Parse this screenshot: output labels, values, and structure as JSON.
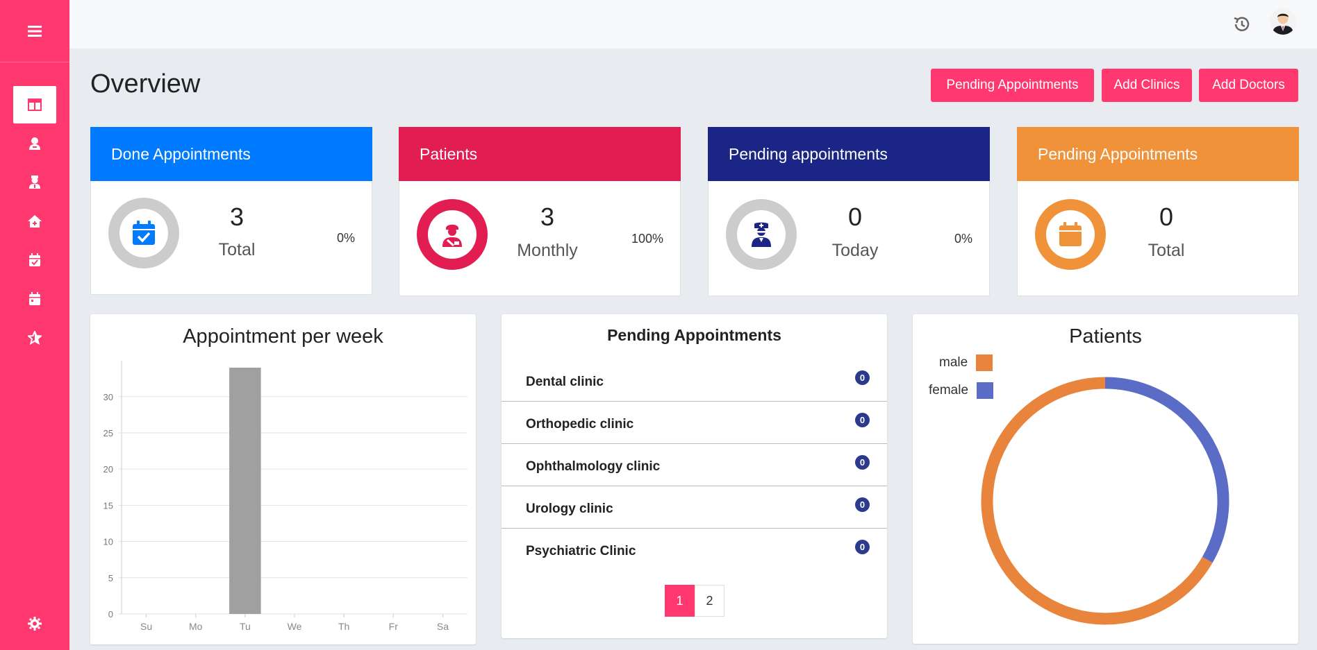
{
  "sidebar": {
    "menu_icon": "menu-icon",
    "items": [
      {
        "icon": "dashboard-icon",
        "active": true
      },
      {
        "icon": "user-icon"
      },
      {
        "icon": "doctor-icon"
      },
      {
        "icon": "clinic-icon"
      },
      {
        "icon": "calendar-check-icon"
      },
      {
        "icon": "calendar-icon"
      },
      {
        "icon": "star-icon"
      }
    ],
    "settings_icon": "gear-icon"
  },
  "topbar": {
    "history_icon": "history-icon",
    "avatar_icon": "avatar"
  },
  "header": {
    "title": "Overview",
    "buttons": [
      "Pending Appointments",
      "Add Clinics",
      "Add Doctors"
    ]
  },
  "stats": [
    {
      "title": "Done Appointments",
      "value": "3",
      "label": "Total",
      "percent": "0%",
      "color": "#007bff",
      "ring_color": "#cccccc",
      "icon_color": "#007bff",
      "icon": "calendar-check-icon"
    },
    {
      "title": "Patients",
      "value": "3",
      "label": "Monthly",
      "percent": "100%",
      "color": "#e11d52",
      "ring_color": "#e11d52",
      "icon_color": "#e11d52",
      "icon": "patient-icon"
    },
    {
      "title": "Pending appointments",
      "value": "0",
      "label": "Today",
      "percent": "0%",
      "color": "#1a2585",
      "ring_color": "#cccccc",
      "icon_color": "#1a2585",
      "icon": "nurse-icon"
    },
    {
      "title": "Pending Appointments",
      "value": "0",
      "label": "Total",
      "percent": "",
      "color": "#f0923a",
      "ring_color": "#f0923a",
      "icon_color": "#f0923a",
      "icon": "calendar-icon"
    }
  ],
  "weekly": {
    "title": "Appointment per week",
    "chart_data": {
      "type": "bar",
      "title": "Appointment per week",
      "categories": [
        "Su",
        "Mo",
        "Tu",
        "We",
        "Th",
        "Fr",
        "Sa"
      ],
      "values": [
        0,
        0,
        34,
        0,
        0,
        0,
        0
      ],
      "ylim": [
        0,
        34
      ],
      "yticks": [
        0,
        5,
        10,
        15,
        20,
        25,
        30
      ],
      "xlabel": "",
      "ylabel": "",
      "grid": true,
      "bar_color": "#a0a0a0"
    }
  },
  "pending": {
    "title": "Pending Appointments",
    "rows": [
      {
        "name": "Dental clinic",
        "count": "0"
      },
      {
        "name": "Orthopedic clinic",
        "count": "0"
      },
      {
        "name": "Ophthalmology clinic",
        "count": "0"
      },
      {
        "name": "Urology clinic",
        "count": "0"
      },
      {
        "name": "Psychiatric Clinic",
        "count": "0"
      }
    ],
    "pages": [
      "1",
      "2"
    ],
    "current_page": "1"
  },
  "patients_chart": {
    "title": "Patients",
    "chart_data": {
      "type": "pie",
      "title": "Patients",
      "labels": [
        "male",
        "female"
      ],
      "values": [
        2,
        1
      ],
      "colors": [
        "#e8843c",
        "#5b6cc6"
      ],
      "legend": "top-left"
    }
  }
}
